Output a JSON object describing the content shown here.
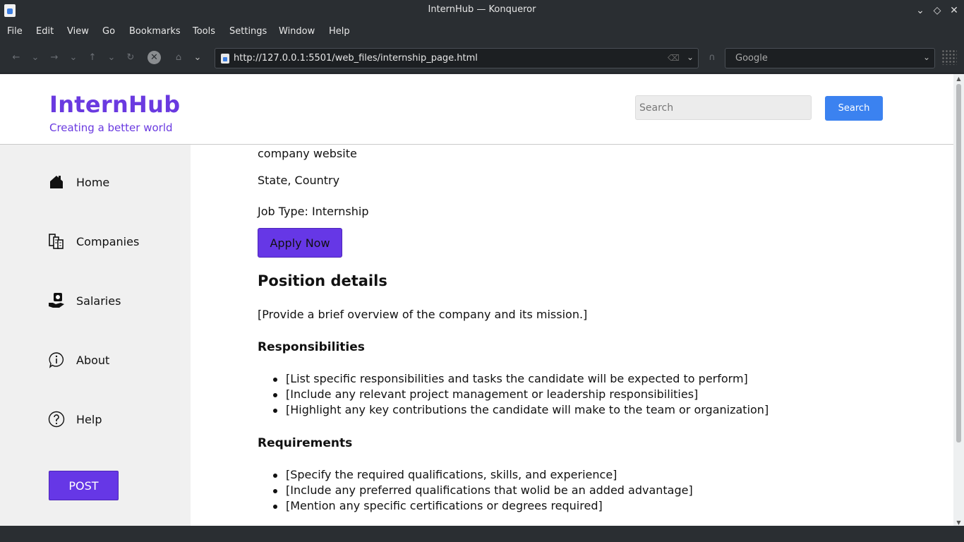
{
  "window": {
    "title": "InternHub — Konqueror"
  },
  "menu": [
    "File",
    "Edit",
    "View",
    "Go",
    "Bookmarks",
    "Tools",
    "Settings",
    "Window",
    "Help"
  ],
  "toolbar": {
    "url": "http://127.0.0.1:5501/web_files/internship_page.html",
    "search_engine": "Google"
  },
  "site": {
    "brand": "InternHub",
    "tagline": "Creating a better world",
    "search_placeholder": "Search",
    "search_button": "Search"
  },
  "sidebar": {
    "items": [
      {
        "label": "Home",
        "icon": "home-icon"
      },
      {
        "label": "Companies",
        "icon": "companies-icon"
      },
      {
        "label": "Salaries",
        "icon": "salaries-icon"
      },
      {
        "label": "About",
        "icon": "info-icon"
      },
      {
        "label": "Help",
        "icon": "help-icon"
      }
    ],
    "post_button": "POST"
  },
  "job": {
    "website": "company website",
    "location": "State, Country",
    "job_type": "Job Type: Internship",
    "apply_button": "Apply Now",
    "position_heading": "Position details",
    "overview": "[Provide a brief overview of the company and its mission.]",
    "responsibilities_heading": "Responsibilities",
    "responsibilities": [
      "[List specific responsibilities and tasks the candidate will be expected to perform]",
      "[Include any relevant project management or leadership responsibilities]",
      "[Highlight any key contributions the candidate will make to the team or organization]"
    ],
    "requirements_heading": "Requirements",
    "requirements": [
      "[Specify the required qualifications, skills, and experience]",
      "[Include any preferred qualifications that wolid be an added advantage]",
      "[Mention any specific certifications or degrees required]"
    ]
  },
  "colors": {
    "brand": "#6a3ae0",
    "primary_button": "#6637e6",
    "search_button": "#3b82f0",
    "sidebar_bg": "#f0f0f0"
  }
}
